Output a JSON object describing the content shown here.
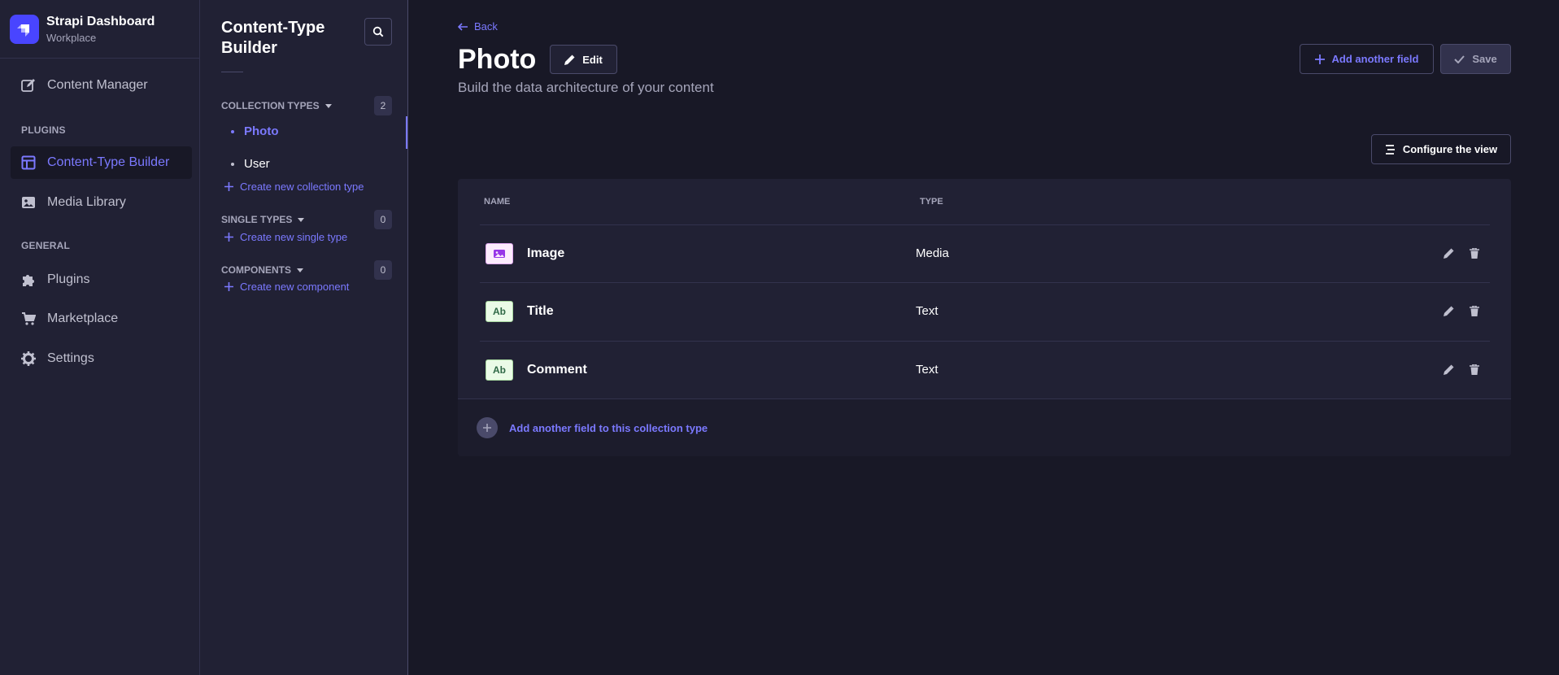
{
  "brand": {
    "title": "Strapi Dashboard",
    "subtitle": "Workplace"
  },
  "mainnav": {
    "content_manager": "Content Manager",
    "plugins_heading": "PLUGINS",
    "content_type_builder": "Content-Type Builder",
    "media_library": "Media Library",
    "general_heading": "GENERAL",
    "plugins": "Plugins",
    "marketplace": "Marketplace",
    "settings": "Settings"
  },
  "subnav": {
    "title": "Content-Type Builder",
    "collection_types": {
      "label": "COLLECTION TYPES",
      "count": "2",
      "items": [
        "Photo",
        "User"
      ],
      "create": "Create new collection type"
    },
    "single_types": {
      "label": "SINGLE TYPES",
      "count": "0",
      "create": "Create new single type"
    },
    "components": {
      "label": "COMPONENTS",
      "count": "0",
      "create": "Create new component"
    }
  },
  "header": {
    "back": "Back",
    "title": "Photo",
    "edit": "Edit",
    "subtitle": "Build the data architecture of your content",
    "add_field": "Add another field",
    "save": "Save",
    "configure_view": "Configure the view"
  },
  "table": {
    "columns": {
      "name": "NAME",
      "type": "TYPE"
    },
    "rows": [
      {
        "name": "Image",
        "type": "Media",
        "icon": "media-icon"
      },
      {
        "name": "Title",
        "type": "Text",
        "icon_label": "Ab"
      },
      {
        "name": "Comment",
        "type": "Text",
        "icon_label": "Ab"
      }
    ],
    "footer_add": "Add another field to this collection type"
  },
  "colors": {
    "accent": "#7b79ff",
    "brand": "#4945ff",
    "background": "#181826",
    "panel": "#212134"
  }
}
